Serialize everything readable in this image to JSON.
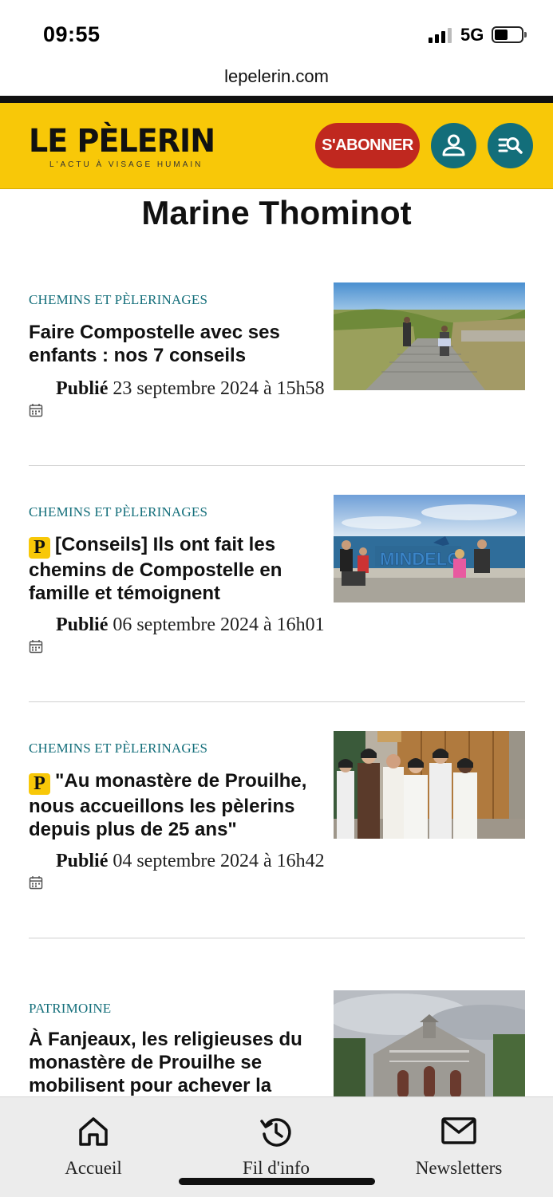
{
  "status_bar": {
    "time": "09:55",
    "network": "5G"
  },
  "browser": {
    "url": "lepelerin.com"
  },
  "header": {
    "logo": "LE PÈLERIN",
    "tagline": "L'ACTU À VISAGE HUMAIN",
    "subscribe_label": "S'ABONNER",
    "account_icon": "user-icon",
    "search_icon": "search-menu-icon",
    "brand_color": "#f8c808",
    "accent_color": "#136e7a",
    "subscribe_color": "#c0281f"
  },
  "page": {
    "title": "Marine Thominot"
  },
  "articles": [
    {
      "rubric": "CHEMINS ET PÈLERINAGES",
      "premium": false,
      "headline": "Faire Compostelle avec ses enfants : nos 7 conseils",
      "published_label": "Publié",
      "date": "23 septembre 2024 à 15h58"
    },
    {
      "rubric": "CHEMINS ET PÈLERINAGES",
      "premium": true,
      "premium_badge": "P",
      "headline": "[Conseils] Ils ont fait les chemins de Compostelle en famille et témoignent",
      "published_label": "Publié",
      "date": "06 septembre 2024 à 16h01"
    },
    {
      "rubric": "CHEMINS ET PÈLERINAGES",
      "premium": true,
      "premium_badge": "P",
      "headline": "\"Au monastère de Prouilhe, nous accueillons les pèlerins depuis plus de 25 ans\"",
      "published_label": "Publié",
      "date": "04 septembre 2024 à 16h42"
    },
    {
      "rubric": "PATRIMOINE",
      "premium": false,
      "headline": "À Fanjeaux, les religieuses du monastère de Prouilhe se mobilisent pour achever la",
      "published_label": "",
      "date": ""
    }
  ],
  "tab_bar": {
    "items": [
      {
        "label": "Accueil",
        "icon": "home-icon"
      },
      {
        "label": "Fil d'info",
        "icon": "history-icon"
      },
      {
        "label": "Newsletters",
        "icon": "mail-icon"
      }
    ]
  }
}
